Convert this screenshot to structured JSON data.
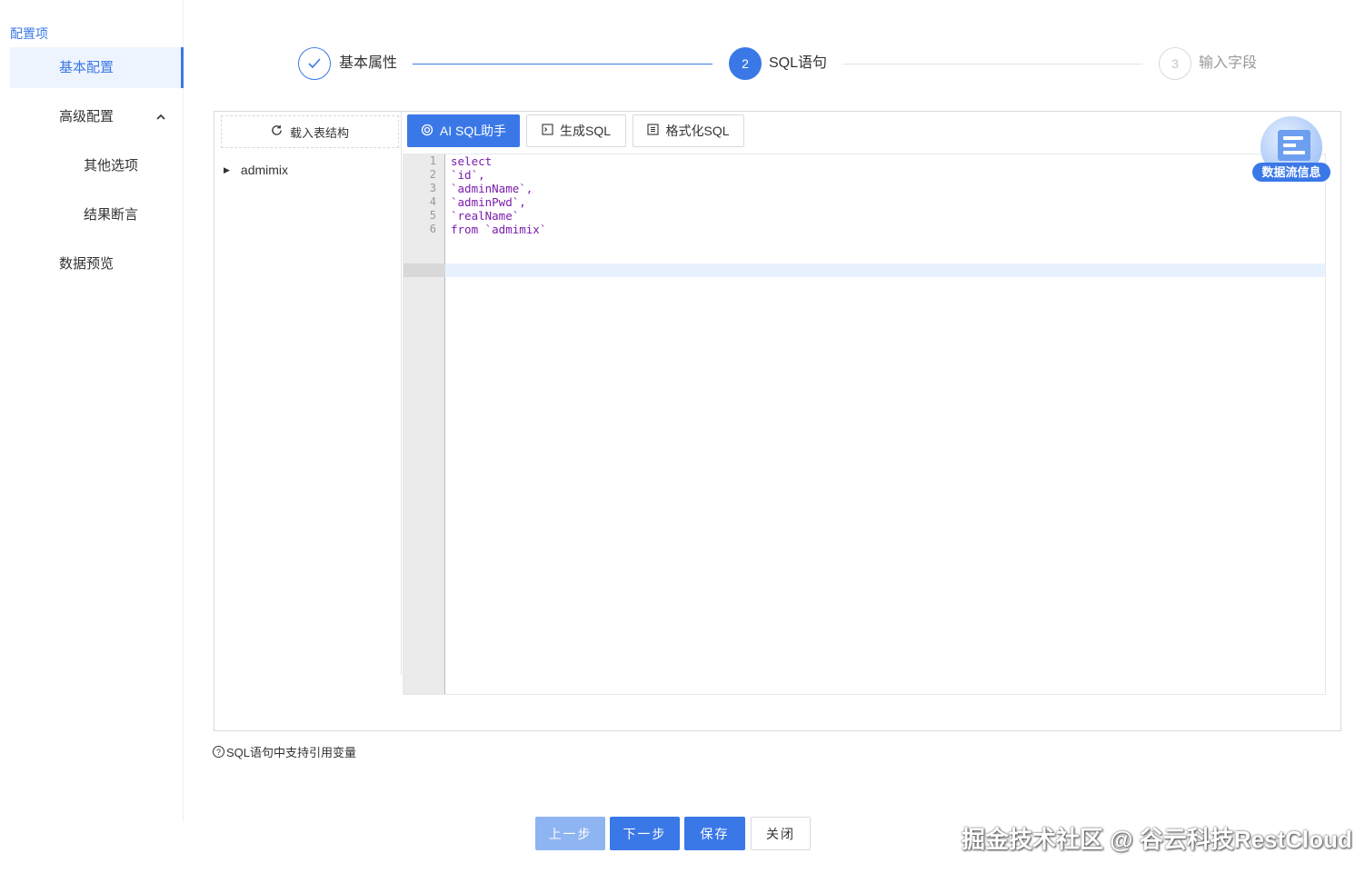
{
  "sidebar": {
    "header": "配置项",
    "items": [
      {
        "label": "基本配置"
      },
      {
        "label": "高级配置"
      },
      {
        "label": "其他选项"
      },
      {
        "label": "结果断言"
      },
      {
        "label": "数据预览"
      }
    ]
  },
  "steps": [
    {
      "number": "1",
      "label": "基本属性",
      "state": "done"
    },
    {
      "number": "2",
      "label": "SQL语句",
      "state": "active"
    },
    {
      "number": "3",
      "label": "输入字段",
      "state": "todo"
    }
  ],
  "tree": {
    "load_button": "载入表结构",
    "nodes": [
      "admimix"
    ]
  },
  "toolbar": {
    "ai_button": "AI SQL助手",
    "generate_button": "生成SQL",
    "format_button": "格式化SQL"
  },
  "editor": {
    "line_numbers": [
      "1",
      "2",
      "3",
      "4",
      "5",
      "6"
    ],
    "lines": [
      "select",
      "`id`,",
      "`adminName`,",
      "`adminPwd`,",
      "`realName`",
      "from `admimix`"
    ]
  },
  "badge": {
    "label": "数据流信息"
  },
  "hint": "SQL语句中支持引用变量",
  "footer": {
    "prev": "上一步",
    "next": "下一步",
    "save": "保存",
    "close": "关闭"
  },
  "watermark": "掘金技术社区 @ 谷云科技RestCloud",
  "colors": {
    "primary": "#3b78e7",
    "primary_disabled": "#8eb4f2"
  }
}
